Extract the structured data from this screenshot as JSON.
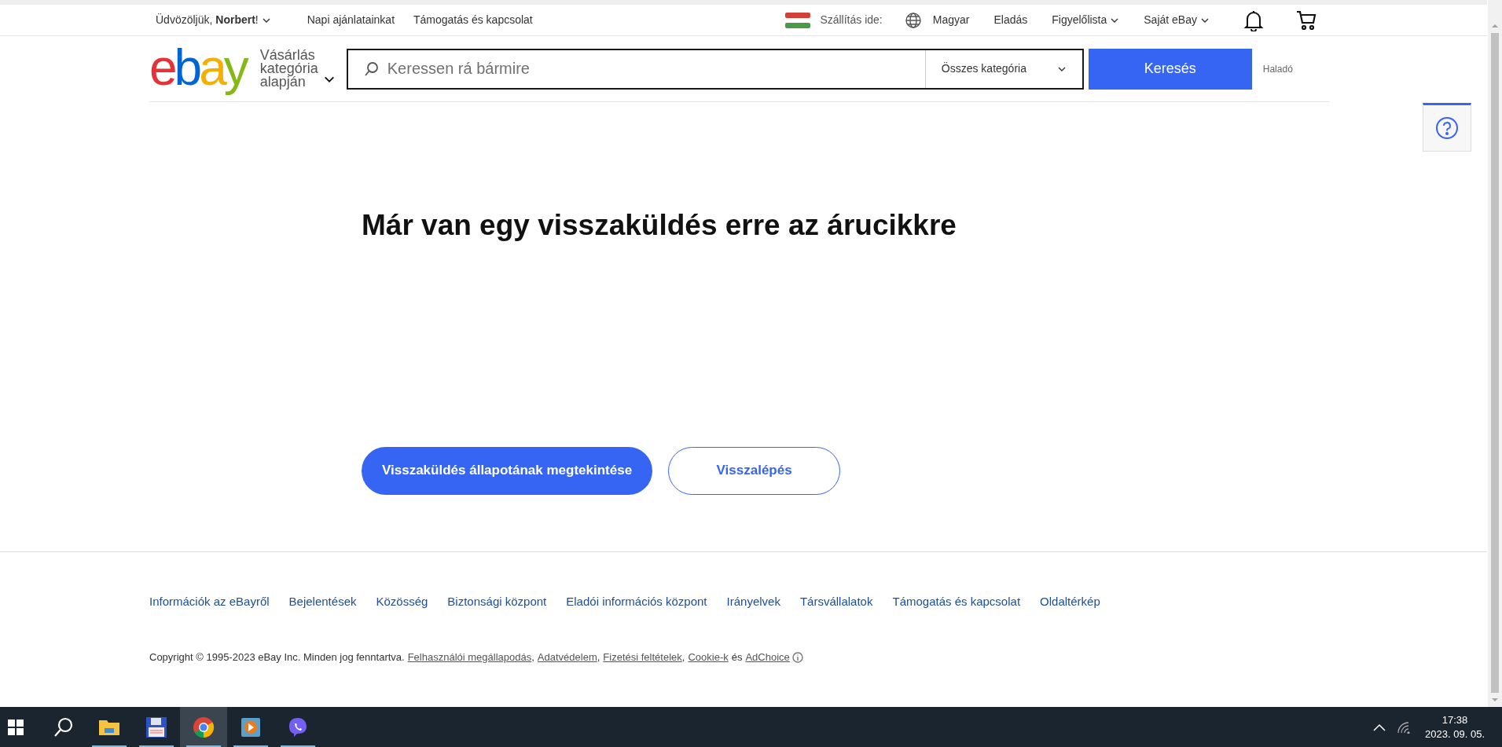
{
  "top_nav": {
    "greeting": "Üdvözöljük, **Norbert**!",
    "left_links": [
      "Napi ajánlatainkat",
      "Támogatás és kapcsolat"
    ],
    "ship_to": "Szállítás ide:",
    "language": "Magyar",
    "right_links": [
      {
        "label": "Eladás",
        "dropdown": false
      },
      {
        "label": "Figyelőlista",
        "dropdown": true
      },
      {
        "label": "Saját eBay",
        "dropdown": true
      }
    ]
  },
  "header": {
    "logo": "ebay",
    "category_menu": "Vásárlás kategória alapján",
    "search": {
      "placeholder": "Keressen rá bármire"
    },
    "category_select": "Összes kategória",
    "search_button": "Keresés",
    "advanced": "Haladó"
  },
  "main": {
    "heading": "Már van egy visszaküldés erre az árucikkre",
    "primary_button": "Visszaküldés állapotának megtekintése",
    "secondary_button": "Visszalépés"
  },
  "footer": {
    "links": [
      "Információk az eBayről",
      "Bejelentések",
      "Közösség",
      "Biztonsági központ",
      "Eladói információs központ",
      "Irányelvek",
      "Társvállalatok",
      "Támogatás és kapcsolat",
      "Oldaltérkép"
    ],
    "copyright": "Copyright © 1995-2023 eBay Inc. Minden jog fenntartva.",
    "legal_links": [
      "Felhasználói megállapodás",
      "Adatvédelem",
      "Fizetési feltételek",
      "Cookie-k"
    ],
    "separator": ",",
    "conjunction": "és",
    "adchoice": "AdChoice"
  },
  "taskbar": {
    "apps": [
      {
        "kind": "explorer",
        "selected": false
      },
      {
        "kind": "disk",
        "selected": false
      },
      {
        "kind": "chrome",
        "selected": true
      },
      {
        "kind": "player",
        "selected": false
      },
      {
        "kind": "viber",
        "selected": false
      }
    ],
    "time": "17:38",
    "date": "2023. 09. 05."
  }
}
